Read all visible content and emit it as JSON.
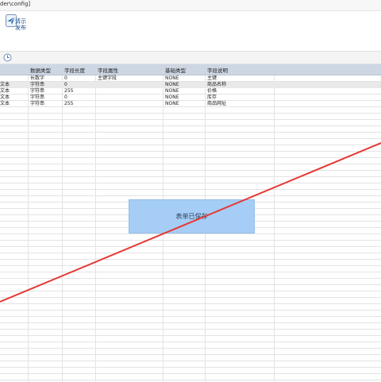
{
  "window": {
    "title": "der\\config]"
  },
  "ribbon": {
    "publish_label_1": "清示",
    "publish_label_2": "发布"
  },
  "table": {
    "columns": [
      "数据类型",
      "字段长度",
      "字段属性",
      "基础类型",
      "字段说明"
    ],
    "rows": [
      {
        "type_tail": "",
        "data_type": "长数字",
        "length": "0",
        "attr": "主键字段",
        "base": "NONE",
        "desc": "主键"
      },
      {
        "type_tail": "文本",
        "data_type": "字符串",
        "length": "0",
        "attr": "",
        "base": "NONE",
        "desc": "商品名称"
      },
      {
        "type_tail": "文本",
        "data_type": "字符串",
        "length": "255",
        "attr": "",
        "base": "NONE",
        "desc": "价格"
      },
      {
        "type_tail": "文本",
        "data_type": "字符串",
        "length": "0",
        "attr": "",
        "base": "NONE",
        "desc": "库存"
      },
      {
        "type_tail": "文本",
        "data_type": "字符串",
        "length": "255",
        "attr": "",
        "base": "NONE",
        "desc": "商品网址"
      }
    ]
  },
  "toast": {
    "message": "表单已保存"
  },
  "colors": {
    "header_bg": "#cdd6e3",
    "toast_bg": "#a6cdf6",
    "annotation_line": "#e53935"
  },
  "icons": {
    "publish": "paper-plane-icon",
    "refresh": "refresh-icon"
  }
}
